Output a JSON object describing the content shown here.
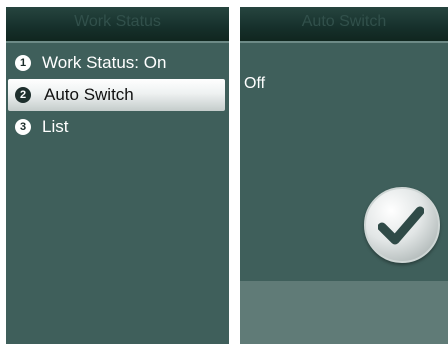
{
  "work_status_screen": {
    "title": "Work Status",
    "items": [
      {
        "number": "1",
        "label": "Work Status: On"
      },
      {
        "number": "2",
        "label": "Auto Switch"
      },
      {
        "number": "3",
        "label": "List"
      }
    ],
    "selected_item": "Auto Switch"
  },
  "auto_switch_screen": {
    "title": "Auto Switch",
    "value": "Off",
    "confirm_icon": "checkmark-icon"
  }
}
